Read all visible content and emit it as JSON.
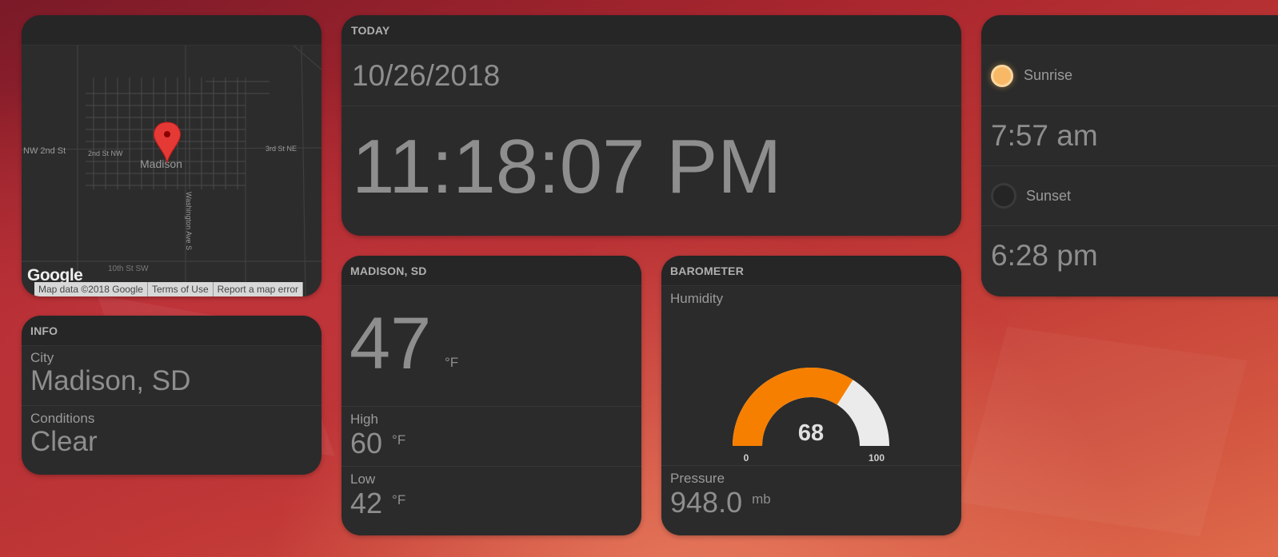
{
  "map": {
    "labels": {
      "nw2nd": "NW 2nd St",
      "2ndnw": "2nd St NW",
      "madison": "Madison",
      "3rdne": "3rd St NE",
      "washington": "Washington Ave S",
      "10th": "10th St SW"
    },
    "logo": "Google",
    "attribution": [
      "Map data ©2018 Google",
      "Terms of Use",
      "Report a map error"
    ]
  },
  "info": {
    "header": "INFO",
    "city_label": "City",
    "city_value": "Madison, SD",
    "conditions_label": "Conditions",
    "conditions_value": "Clear"
  },
  "today": {
    "header": "TODAY",
    "date": "10/26/2018",
    "time": "11:18:07 PM"
  },
  "sun": {
    "sunrise_label": "Sunrise",
    "sunrise_time": "7:57 am",
    "sunset_label": "Sunset",
    "sunset_time": "6:28 pm"
  },
  "weather": {
    "header": "MADISON, SD",
    "temp": "47",
    "temp_unit": "°F",
    "high_label": "High",
    "high_value": "60",
    "high_unit": "°F",
    "low_label": "Low",
    "low_value": "42",
    "low_unit": "°F"
  },
  "barometer": {
    "header": "BAROMETER",
    "humidity_label": "Humidity",
    "humidity_value": 68,
    "humidity_display": "68",
    "gauge_min": "0",
    "gauge_max": "100",
    "pressure_label": "Pressure",
    "pressure_value": "948.0",
    "pressure_unit": "mb"
  },
  "colors": {
    "gauge_fill": "#f77f00",
    "gauge_track": "#ebebeb",
    "sunrise_dot": "#f8b865",
    "card_bg": "#2b2b2b"
  }
}
